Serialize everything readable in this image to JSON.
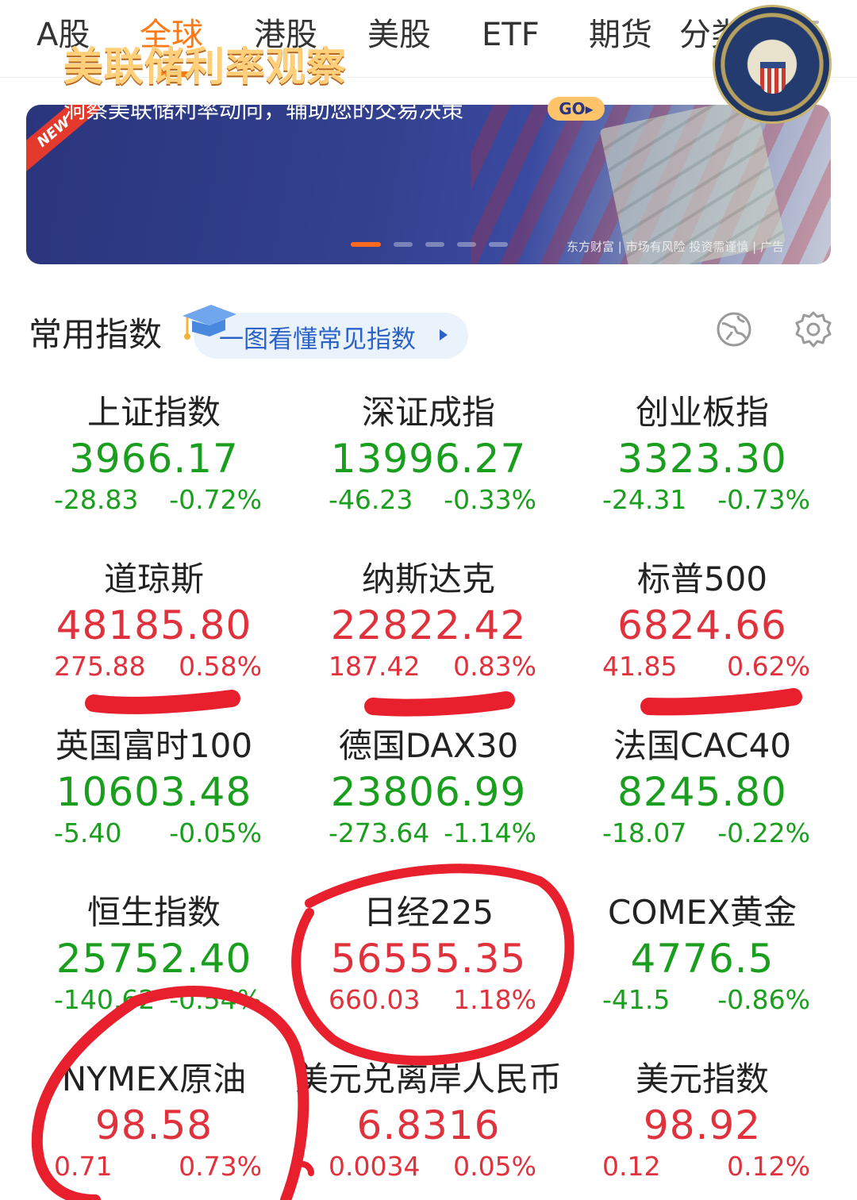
{
  "tabs": [
    {
      "label": "A股",
      "active": false
    },
    {
      "label": "全球",
      "active": true
    },
    {
      "label": "港股",
      "active": false
    },
    {
      "label": "美股",
      "active": false
    },
    {
      "label": "ETF",
      "active": false
    },
    {
      "label": "期货",
      "active": false
    },
    {
      "label": "分类",
      "active": false
    }
  ],
  "banner": {
    "ribbon": "NEW",
    "title": "美联储利率观察",
    "subtitle": "洞察美联储利率动向，辅助您的交易决策",
    "go_label": "GO▸",
    "ad_note": "东方财富 | 市场有风险 投资需谨慎 | 广告"
  },
  "section": {
    "title": "常用指数",
    "guide_link": "一图看懂常见指数"
  },
  "colors": {
    "accent": "#ff7a14",
    "up": "#e0323c",
    "down": "#1a9e1e",
    "link": "#2c63c9"
  },
  "indices": [
    {
      "name": "上证指数",
      "value": "3966.17",
      "change": "-28.83",
      "pct": "-0.72%",
      "trend": "down"
    },
    {
      "name": "深证成指",
      "value": "13996.27",
      "change": "-46.23",
      "pct": "-0.33%",
      "trend": "down"
    },
    {
      "name": "创业板指",
      "value": "3323.30",
      "change": "-24.31",
      "pct": "-0.73%",
      "trend": "down"
    },
    {
      "name": "道琼斯",
      "value": "48185.80",
      "change": "275.88",
      "pct": "0.58%",
      "trend": "up"
    },
    {
      "name": "纳斯达克",
      "value": "22822.42",
      "change": "187.42",
      "pct": "0.83%",
      "trend": "up"
    },
    {
      "name": "标普500",
      "value": "6824.66",
      "change": "41.85",
      "pct": "0.62%",
      "trend": "up"
    },
    {
      "name": "英国富时100",
      "value": "10603.48",
      "change": "-5.40",
      "pct": "-0.05%",
      "trend": "down"
    },
    {
      "name": "德国DAX30",
      "value": "23806.99",
      "change": "-273.64",
      "pct": "-1.14%",
      "trend": "down"
    },
    {
      "name": "法国CAC40",
      "value": "8245.80",
      "change": "-18.07",
      "pct": "-0.22%",
      "trend": "down"
    },
    {
      "name": "恒生指数",
      "value": "25752.40",
      "change": "-140.62",
      "pct": "-0.54%",
      "trend": "down"
    },
    {
      "name": "日经225",
      "value": "56555.35",
      "change": "660.03",
      "pct": "1.18%",
      "trend": "up"
    },
    {
      "name": "COMEX黄金",
      "value": "4776.5",
      "change": "-41.5",
      "pct": "-0.86%",
      "trend": "down"
    },
    {
      "name": "NYMEX原油",
      "value": "98.58",
      "change": "0.71",
      "pct": "0.73%",
      "trend": "up"
    },
    {
      "name": "美元兑离岸人民币",
      "value": "6.8316",
      "change": "0.0034",
      "pct": "0.05%",
      "trend": "up"
    },
    {
      "name": "美元指数",
      "value": "98.92",
      "change": "0.12",
      "pct": "0.12%",
      "trend": "up"
    }
  ]
}
